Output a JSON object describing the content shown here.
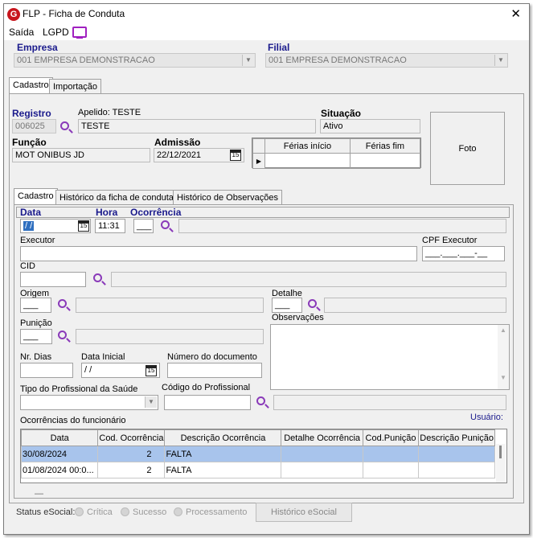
{
  "window": {
    "title": "FLP - Ficha de Conduta",
    "close": "✕"
  },
  "menu": {
    "saida": "Saída",
    "lgpd": "LGPD"
  },
  "empresa": {
    "label": "Empresa",
    "value": "001 EMPRESA DEMONSTRACAO"
  },
  "filial": {
    "label": "Filial",
    "value": "001 EMPRESA DEMONSTRACAO"
  },
  "main_tabs": [
    "Cadastro",
    "Importação"
  ],
  "registro": {
    "label": "Registro",
    "value": "006025"
  },
  "apelido": {
    "label": "Apelido: TESTE",
    "value": "TESTE"
  },
  "situacao": {
    "label": "Situação",
    "value": "Ativo"
  },
  "funcao": {
    "label": "Função",
    "value": "MOT ONIBUS JD"
  },
  "admissao": {
    "label": "Admissão",
    "value": "22/12/2021"
  },
  "ferias": {
    "col1": "Férias início",
    "col2": "Férias fim"
  },
  "photo": {
    "label": "Foto"
  },
  "sub_tabs": [
    "Cadastro",
    "Histórico da ficha de conduta",
    "Histórico de Observações"
  ],
  "form": {
    "data_label": "Data",
    "data_value": " / /",
    "hora_label": "Hora",
    "hora_value": "11:31",
    "ocorrencia_label": "Ocorrência",
    "ocorrencia_value": "___",
    "executor_label": "Executor",
    "cpf_label": "CPF Executor",
    "cpf_value": "___.___.___-__",
    "cid_label": "CID",
    "origem_label": "Origem",
    "origem_value": "___",
    "detalhe_label": "Detalhe",
    "detalhe_value": "___",
    "punicao_label": "Punição",
    "punicao_value": "___",
    "observacoes_label": "Observações",
    "nr_dias_label": "Nr. Dias",
    "data_inicial_label": "Data Inicial",
    "data_inicial_value": " / /",
    "numero_doc_label": "Número do documento",
    "tipo_prof_label": "Tipo do Profissional da Saúde",
    "codigo_prof_label": "Código do Profissional"
  },
  "ocorrencias": {
    "label": "Ocorrências do funcionário",
    "usuario_label": "Usuário:",
    "columns": [
      "Data",
      "Cod. Ocorrência",
      "Descrição Ocorrência",
      "Detalhe Ocorrência",
      "Cod.Punição",
      "Descrição Punição"
    ],
    "rows": [
      {
        "data": "30/08/2024",
        "cod": "2",
        "descricao": "FALTA",
        "detalhe": "",
        "cod_punicao": "",
        "desc_punicao": ""
      },
      {
        "data": "01/08/2024 00:0...",
        "cod": "2",
        "descricao": "FALTA",
        "detalhe": "",
        "cod_punicao": "",
        "desc_punicao": ""
      }
    ],
    "footer_mark": "—"
  },
  "status": {
    "label": "Status eSocial:",
    "options": [
      "Crítica",
      "Sucesso",
      "Processamento"
    ],
    "historico_button": "Histórico eSocial"
  },
  "calendar_glyph": "15"
}
